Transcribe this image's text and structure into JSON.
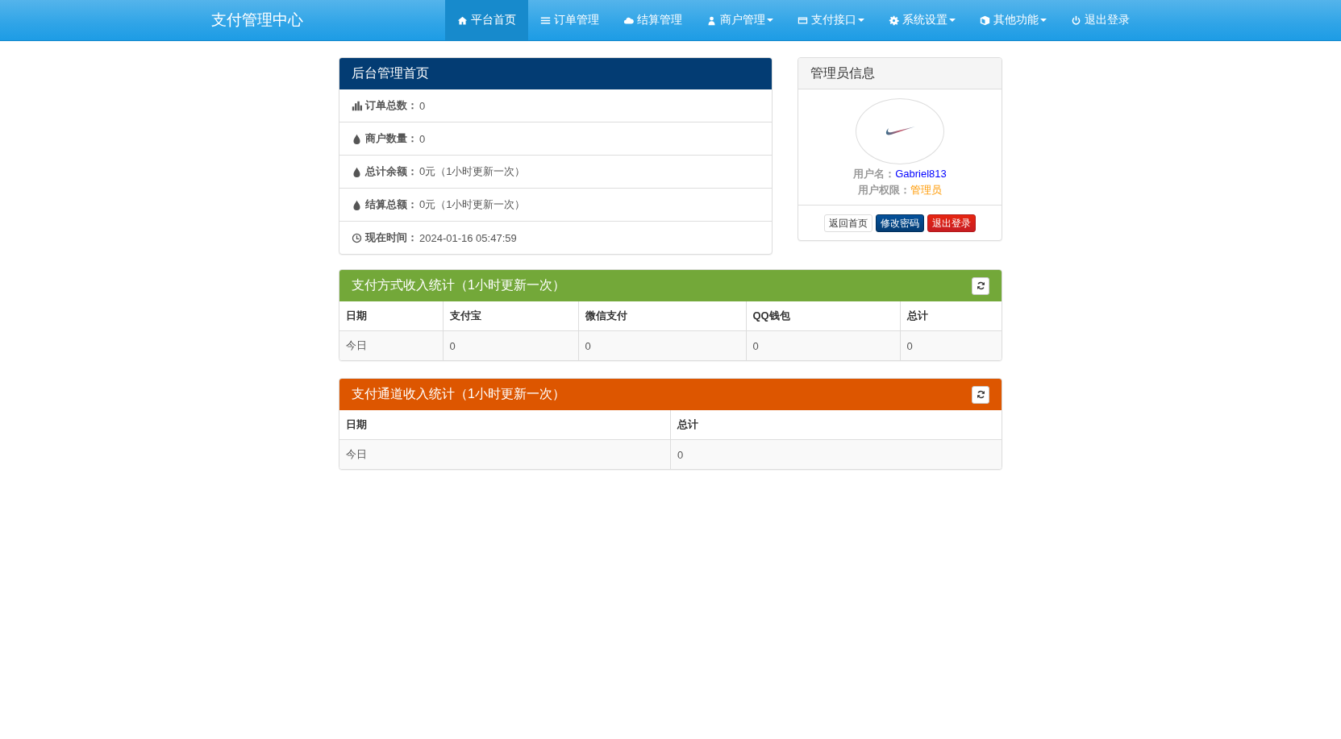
{
  "navbar": {
    "brand": "支付管理中心",
    "items": [
      {
        "label": "平台首页",
        "selected": true,
        "dropdown": false
      },
      {
        "label": "订单管理",
        "selected": false,
        "dropdown": false
      },
      {
        "label": "结算管理",
        "selected": false,
        "dropdown": false
      },
      {
        "label": "商户管理",
        "selected": false,
        "dropdown": true
      },
      {
        "label": "支付接口",
        "selected": false,
        "dropdown": true
      },
      {
        "label": "系统设置",
        "selected": false,
        "dropdown": true
      },
      {
        "label": "其他功能",
        "selected": false,
        "dropdown": true
      },
      {
        "label": "退出登录",
        "selected": false,
        "dropdown": false
      }
    ]
  },
  "overview": {
    "title": "后台管理首页",
    "stats": [
      {
        "label": "订单总数：",
        "value": "0"
      },
      {
        "label": "商户数量：",
        "value": "0"
      },
      {
        "label": "总计余额：",
        "value": "0元（1小时更新一次）"
      },
      {
        "label": "结算总额：",
        "value": "0元（1小时更新一次）"
      },
      {
        "label": "现在时间：",
        "value": "2024-01-16 05:47:59"
      }
    ]
  },
  "admin": {
    "title": "管理员信息",
    "username_label": "用户名：",
    "username": "Gabriel813",
    "role_label": "用户权限：",
    "role": "管理员",
    "buttons": [
      {
        "label": "返回首页",
        "kind": "default"
      },
      {
        "label": "修改密码",
        "kind": "primary"
      },
      {
        "label": "退出登录",
        "kind": "danger"
      }
    ]
  },
  "tables": [
    {
      "title": "支付方式收入统计（1小时更新一次）",
      "color": "#73a839",
      "columns": [
        "日期",
        "支付宝",
        "微信支付",
        "QQ钱包",
        "总计"
      ],
      "rows": [
        [
          "今日",
          "0",
          "0",
          "0",
          "0"
        ]
      ]
    },
    {
      "title": "支付通道收入统计（1小时更新一次）",
      "color": "#dd5600",
      "columns": [
        "日期",
        "总计"
      ],
      "rows": [
        [
          "今日",
          "0"
        ]
      ]
    }
  ]
}
